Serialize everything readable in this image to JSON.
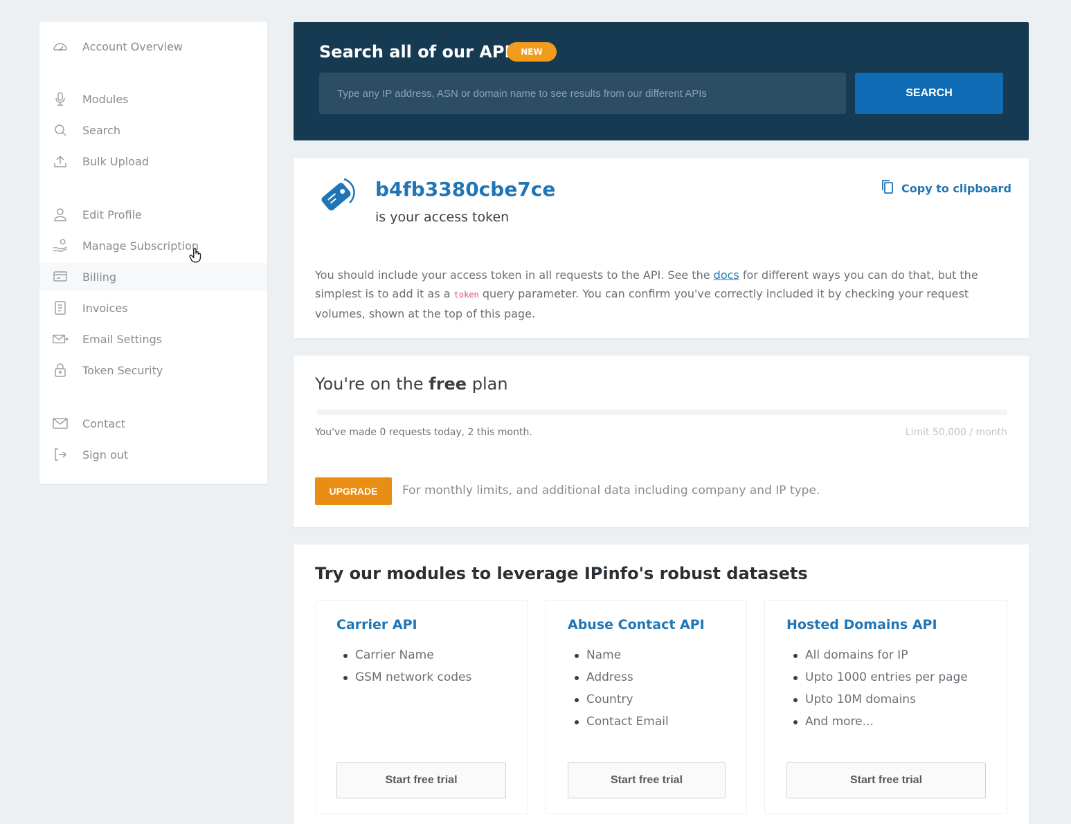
{
  "sidebar": {
    "items": [
      {
        "label": "Account Overview",
        "icon": "dashboard-icon"
      },
      {
        "label": "Modules",
        "icon": "microphone-icon"
      },
      {
        "label": "Search",
        "icon": "search-icon"
      },
      {
        "label": "Bulk Upload",
        "icon": "upload-icon"
      },
      {
        "label": "Edit Profile",
        "icon": "user-icon"
      },
      {
        "label": "Manage Subscription",
        "icon": "hand-coins-icon"
      },
      {
        "label": "Billing",
        "icon": "billing-icon"
      },
      {
        "label": "Invoices",
        "icon": "invoice-icon"
      },
      {
        "label": "Email Settings",
        "icon": "envelope-send-icon"
      },
      {
        "label": "Token Security",
        "icon": "lock-icon"
      },
      {
        "label": "Contact",
        "icon": "mail-icon"
      },
      {
        "label": "Sign out",
        "icon": "sign-out-icon"
      }
    ]
  },
  "search": {
    "title": "Search all of our APIs",
    "badge": "NEW",
    "placeholder": "Type any IP address, ASN or domain name to see results from our different APIs",
    "button": "SEARCH"
  },
  "token": {
    "value": "b4fb3380cbe7ce",
    "subtitle": "is your access token",
    "copy_label": "Copy to clipboard",
    "desc_before": "You should include your access token in all requests to the API. See the",
    "docs_link": "docs",
    "desc_middle": "for different ways you can do that, but the simplest is to add it as a",
    "code_word": "token",
    "desc_after": "query parameter. You can confirm you've correctly included it by checking your request volumes, shown at the top of this page."
  },
  "plan": {
    "title_prefix": "You're on the",
    "plan_name": "free",
    "title_suffix": "plan",
    "usage": "You've made 0 requests today, 2 this month.",
    "limit": "Limit 50,000 / month",
    "progress_fraction": 0.0,
    "upgrade_label": "UPGRADE",
    "upgrade_text": "For monthly limits, and additional data including company and IP type."
  },
  "modules": {
    "title": "Try our modules to leverage IPinfo's robust datasets",
    "items": [
      {
        "name": "Carrier API",
        "features": [
          "Carrier Name",
          "GSM network codes"
        ],
        "button": "Start free trial"
      },
      {
        "name": "Abuse Contact API",
        "features": [
          "Name",
          "Address",
          "Country",
          "Contact Email"
        ],
        "button": "Start free trial"
      },
      {
        "name": "Hosted Domains API",
        "features": [
          "All domains for IP",
          "Upto 1000 entries per page",
          "Upto 10M domains",
          "And more..."
        ],
        "button": "Start free trial"
      }
    ]
  },
  "colors": {
    "accent": "#1f75b5",
    "search_panel": "#153a52",
    "upgrade": "#e98e15",
    "badge": "#f19c1d"
  }
}
